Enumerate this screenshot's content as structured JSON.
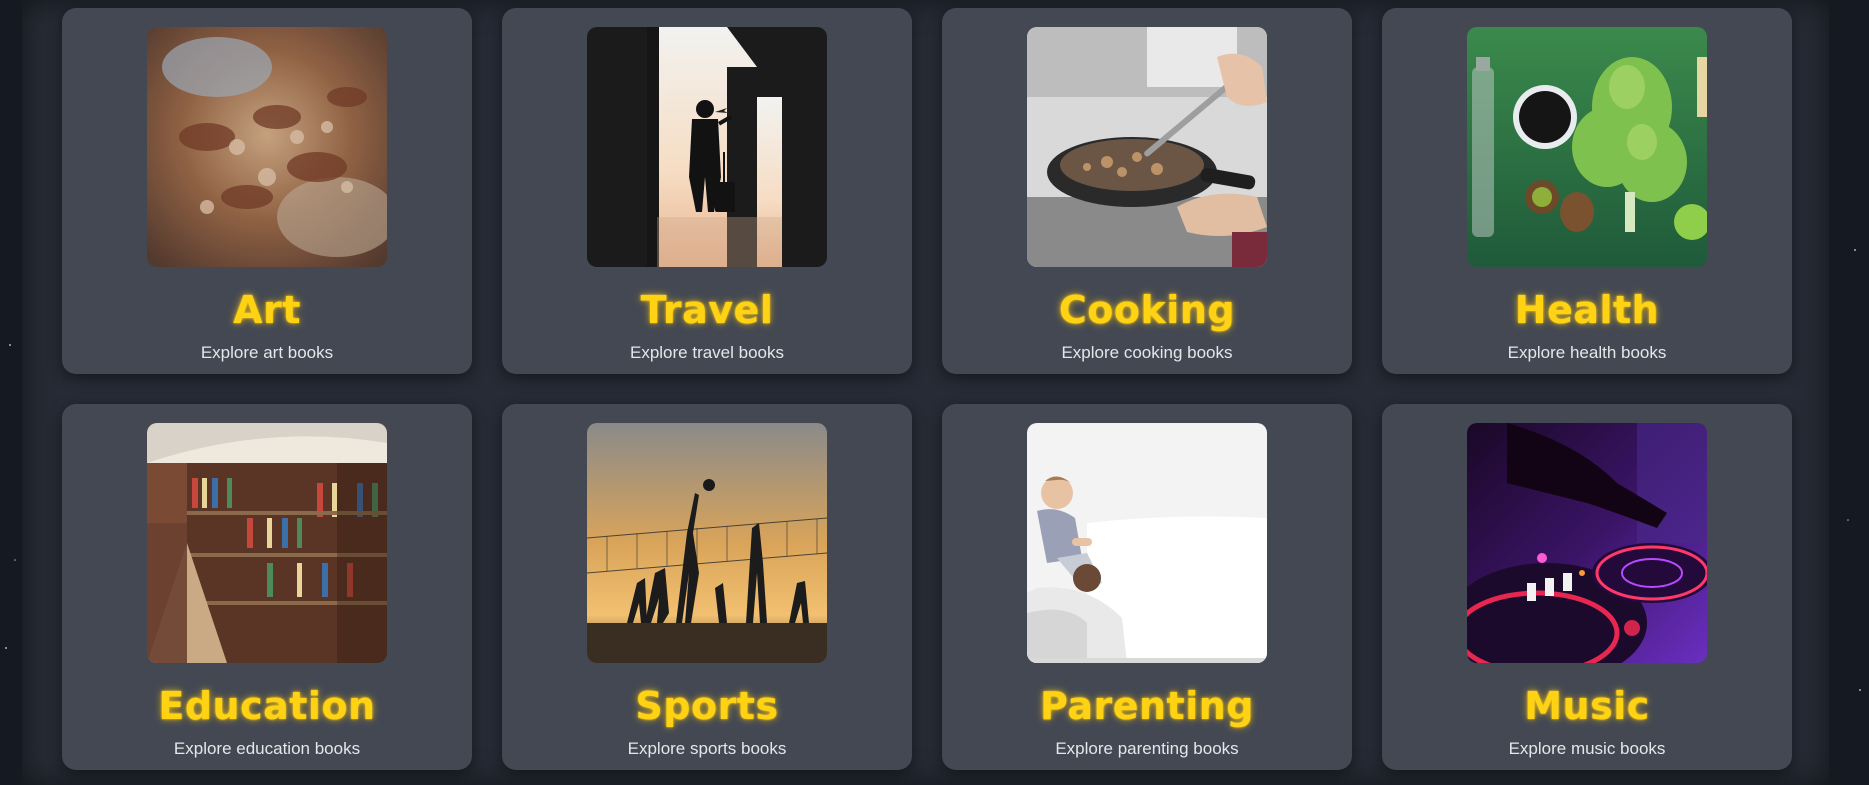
{
  "colors": {
    "background": "#141922",
    "panel": "#262b35",
    "card": "#434853",
    "title": "#ffd313",
    "description": "#e4e6ea"
  },
  "categories": [
    {
      "title": "Art",
      "description": "Explore art books",
      "image": "baroque-ceiling-painting"
    },
    {
      "title": "Travel",
      "description": "Explore travel books",
      "image": "traveler-silhouette-airport"
    },
    {
      "title": "Cooking",
      "description": "Explore cooking books",
      "image": "frying-pan-stir"
    },
    {
      "title": "Health",
      "description": "Explore health books",
      "image": "vegetables-and-fruit"
    },
    {
      "title": "Education",
      "description": "Explore education books",
      "image": "library-bookshelves"
    },
    {
      "title": "Sports",
      "description": "Explore sports books",
      "image": "beach-volleyball-sunset"
    },
    {
      "title": "Parenting",
      "description": "Explore parenting books",
      "image": "child-on-shoulders"
    },
    {
      "title": "Music",
      "description": "Explore music books",
      "image": "dj-turntable"
    }
  ]
}
